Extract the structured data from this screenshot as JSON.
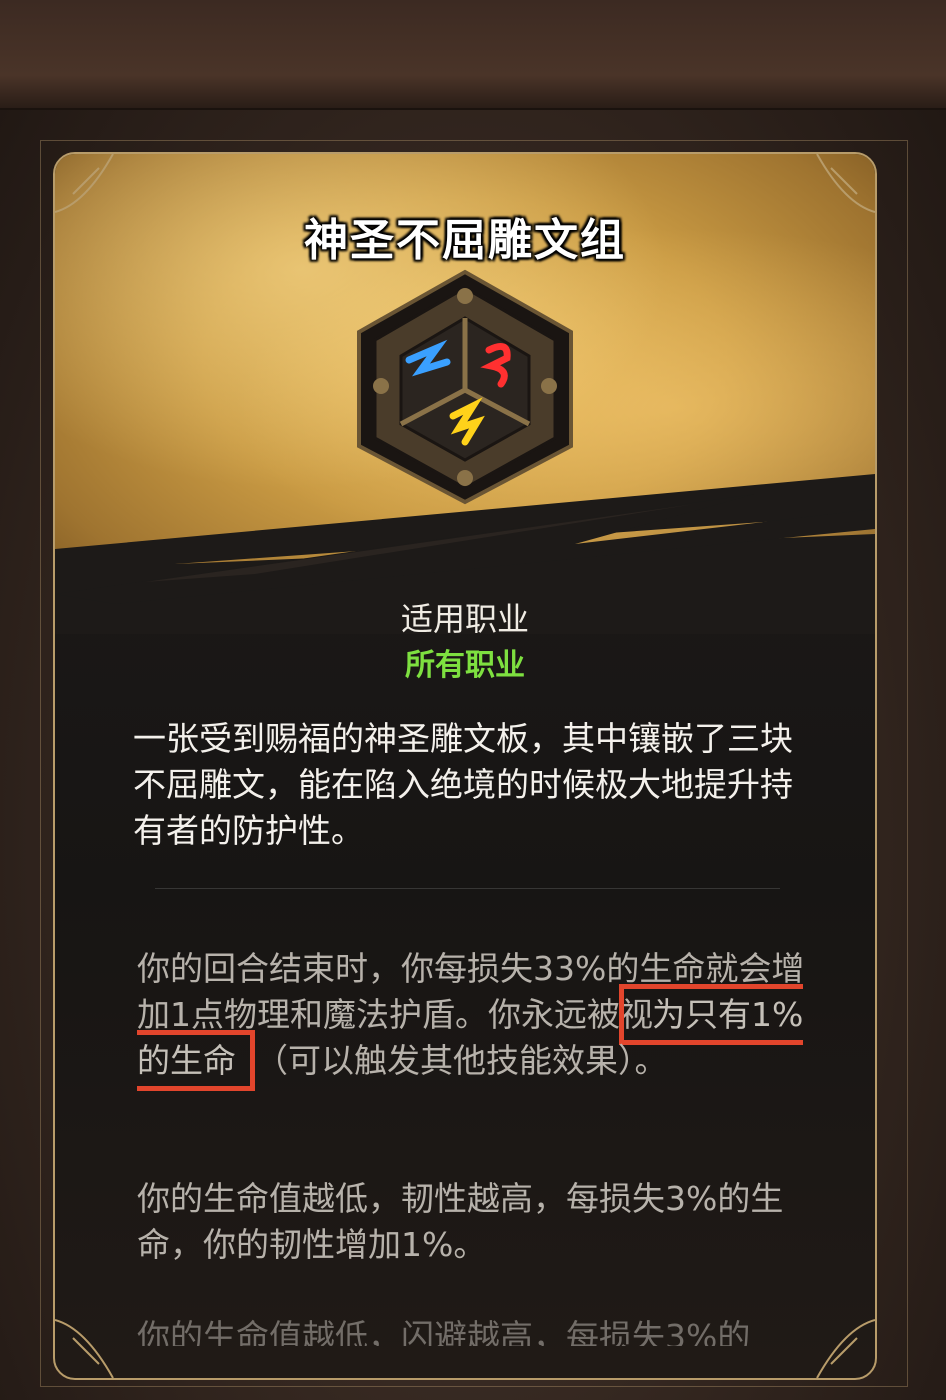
{
  "item": {
    "title": "神圣不屈雕文组",
    "icon": "rune-plate-icon",
    "class_label": "适用职业",
    "class_value": "所有职业",
    "description": "一张受到赐福的神圣雕文板，其中镶嵌了三块不屈雕文，能在陷入绝境的时候极大地提升持有者的防护性。",
    "effect1_before": "你的回合结束时，你每损失33%的生命就会增加1点物理和魔法护盾。你永远被视",
    "effect1_highlight": "为只有1%的生命",
    "effect1_after": "（可以触发其他技能效果）。",
    "effect2": "你的生命值越低，韧性越高，每损失3%的生命，你的韧性增加1%。",
    "effect3": "你的生命值越低，闪避越高，每损失3%的"
  },
  "colors": {
    "highlight_border": "#e2452c",
    "class_value": "#7ee040",
    "frame_gold": "#b89c6a",
    "rune_blue": "#3aa0ff",
    "rune_red": "#ff3030",
    "rune_yellow": "#ffd21a"
  }
}
